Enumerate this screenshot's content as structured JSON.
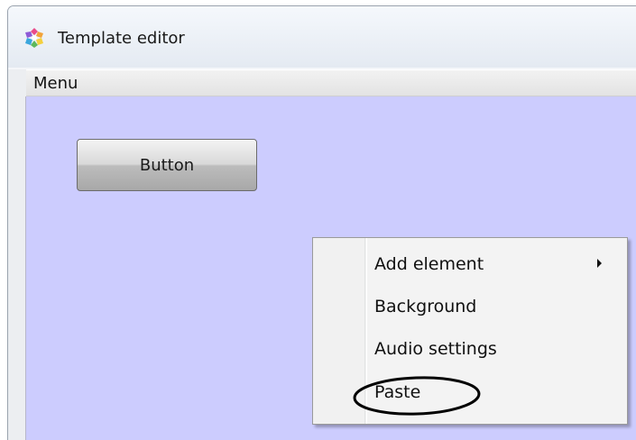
{
  "window": {
    "title": "Template editor",
    "icon": "app-logo-icon"
  },
  "menubar": {
    "menu_label": "Menu"
  },
  "canvas": {
    "background_color": "#ccccfe",
    "button_label": "Button"
  },
  "context_menu": {
    "items": [
      {
        "label": "Add element",
        "has_submenu": true,
        "icon": "submenu-arrow-icon"
      },
      {
        "label": "Background",
        "has_submenu": false
      },
      {
        "label": "Audio settings",
        "has_submenu": false
      },
      {
        "label": "Paste",
        "has_submenu": false,
        "annotated": true
      }
    ]
  },
  "annotation": {
    "shape": "ellipse",
    "color": "#000000",
    "target": "Paste"
  }
}
